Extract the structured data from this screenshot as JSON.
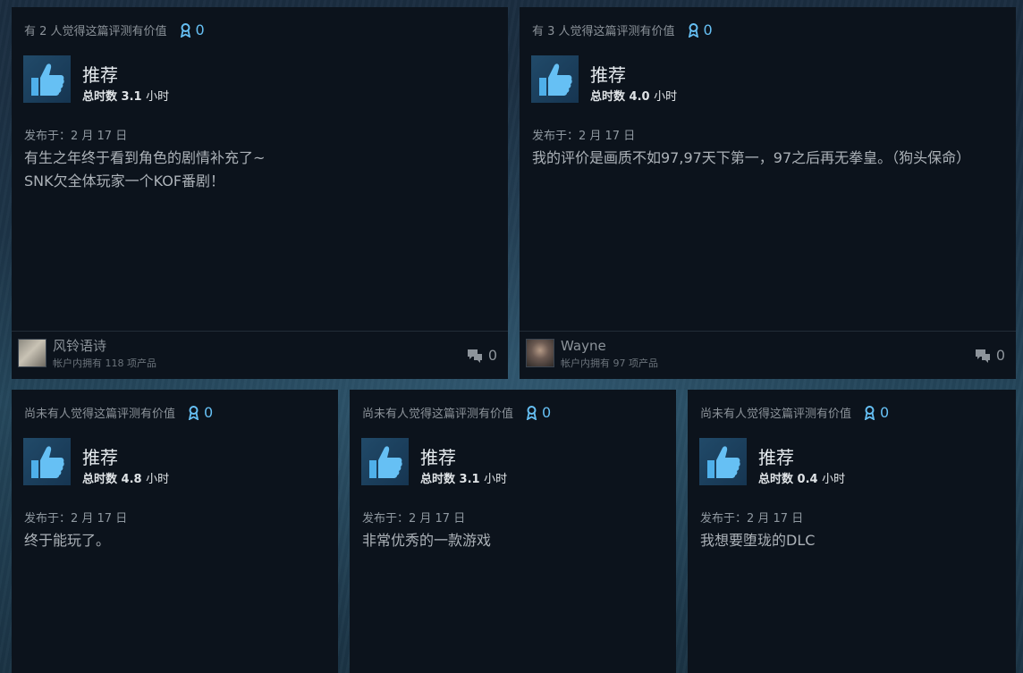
{
  "reviews": [
    {
      "helpful": "有 2 人觉得这篇评测有价值",
      "awards": "0",
      "verdict": "推荐",
      "hours_label": "总时数 3.1",
      "hours_unit": "小时",
      "posted": "发布于：2 月 17 日",
      "content": "有生之年终于看到角色的剧情补充了~\nSNK欠全体玩家一个KOF番剧！",
      "author": "风铃语诗",
      "products": "帐户内拥有 118 项产品",
      "comments": "0"
    },
    {
      "helpful": "有 3 人觉得这篇评测有价值",
      "awards": "0",
      "verdict": "推荐",
      "hours_label": "总时数 4.0",
      "hours_unit": "小时",
      "posted": "发布于：2 月 17 日",
      "content": "我的评价是画质不如97,97天下第一，97之后再无拳皇。（狗头保命）",
      "author": "Wayne",
      "products": "帐户内拥有 97 项产品",
      "comments": "0"
    },
    {
      "helpful": "尚未有人觉得这篇评测有价值",
      "awards": "0",
      "verdict": "推荐",
      "hours_label": "总时数 4.8",
      "hours_unit": "小时",
      "posted": "发布于：2 月 17 日",
      "content": "终于能玩了。"
    },
    {
      "helpful": "尚未有人觉得这篇评测有价值",
      "awards": "0",
      "verdict": "推荐",
      "hours_label": "总时数 3.1",
      "hours_unit": "小时",
      "posted": "发布于：2 月 17 日",
      "content": "非常优秀的一款游戏"
    },
    {
      "helpful": "尚未有人觉得这篇评测有价值",
      "awards": "0",
      "verdict": "推荐",
      "hours_label": "总时数 0.4",
      "hours_unit": "小时",
      "posted": "发布于：2 月 17 日",
      "content": "我想要堕珑的DLC"
    }
  ],
  "icons": {
    "award": "award-ribbon-icon",
    "thumb": "thumbs-up-icon",
    "comment": "comment-bubbles-icon"
  },
  "colors": {
    "card_bg": "#0c131c",
    "accent": "#66c0f4",
    "thumb_tile": "#1c4463"
  }
}
